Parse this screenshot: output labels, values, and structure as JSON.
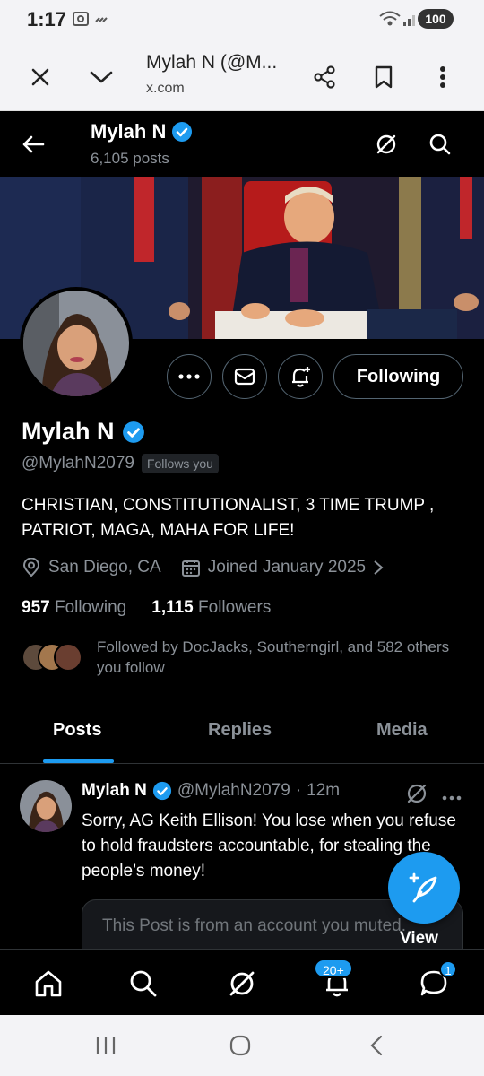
{
  "status_bar": {
    "time": "1:17",
    "battery": "100"
  },
  "browser": {
    "tab_title": "Mylah N (@M...",
    "url": "x.com"
  },
  "header": {
    "name": "Mylah N",
    "post_count": "6,105 posts"
  },
  "profile": {
    "name": "Mylah N",
    "handle": "@MylahN2079",
    "follows_you": "Follows you",
    "bio": "CHRISTIAN, CONSTITUTIONALIST,  3 TIME TRUMP , PATRIOT, MAGA, MAHA FOR LIFE!",
    "location": "San Diego, CA",
    "joined": "Joined January 2025",
    "following_count": "957",
    "following_label": "Following",
    "followers_count": "1,115",
    "followers_label": "Followers",
    "followed_by": "Followed by DocJacks, Southerngirl, and 582 others you follow",
    "following_button": "Following"
  },
  "tabs": [
    {
      "label": "Posts",
      "active": true
    },
    {
      "label": "Replies",
      "active": false
    },
    {
      "label": "Media",
      "active": false
    }
  ],
  "post": {
    "author": "Mylah N",
    "handle": "@MylahN2079",
    "separator": "·",
    "time": "12m",
    "text": "Sorry, AG Keith Ellison! You lose when you refuse to hold fraudsters accountable, for stealing the people’s money!",
    "muted_notice": "This Post is from an account you muted."
  },
  "fab": {
    "label": "View"
  },
  "bottom_nav": {
    "notifications_badge": "20+",
    "messages_badge": "1"
  },
  "colors": {
    "accent": "#1d9bf0",
    "background": "#000000",
    "secondary_text": "#8b9198"
  }
}
